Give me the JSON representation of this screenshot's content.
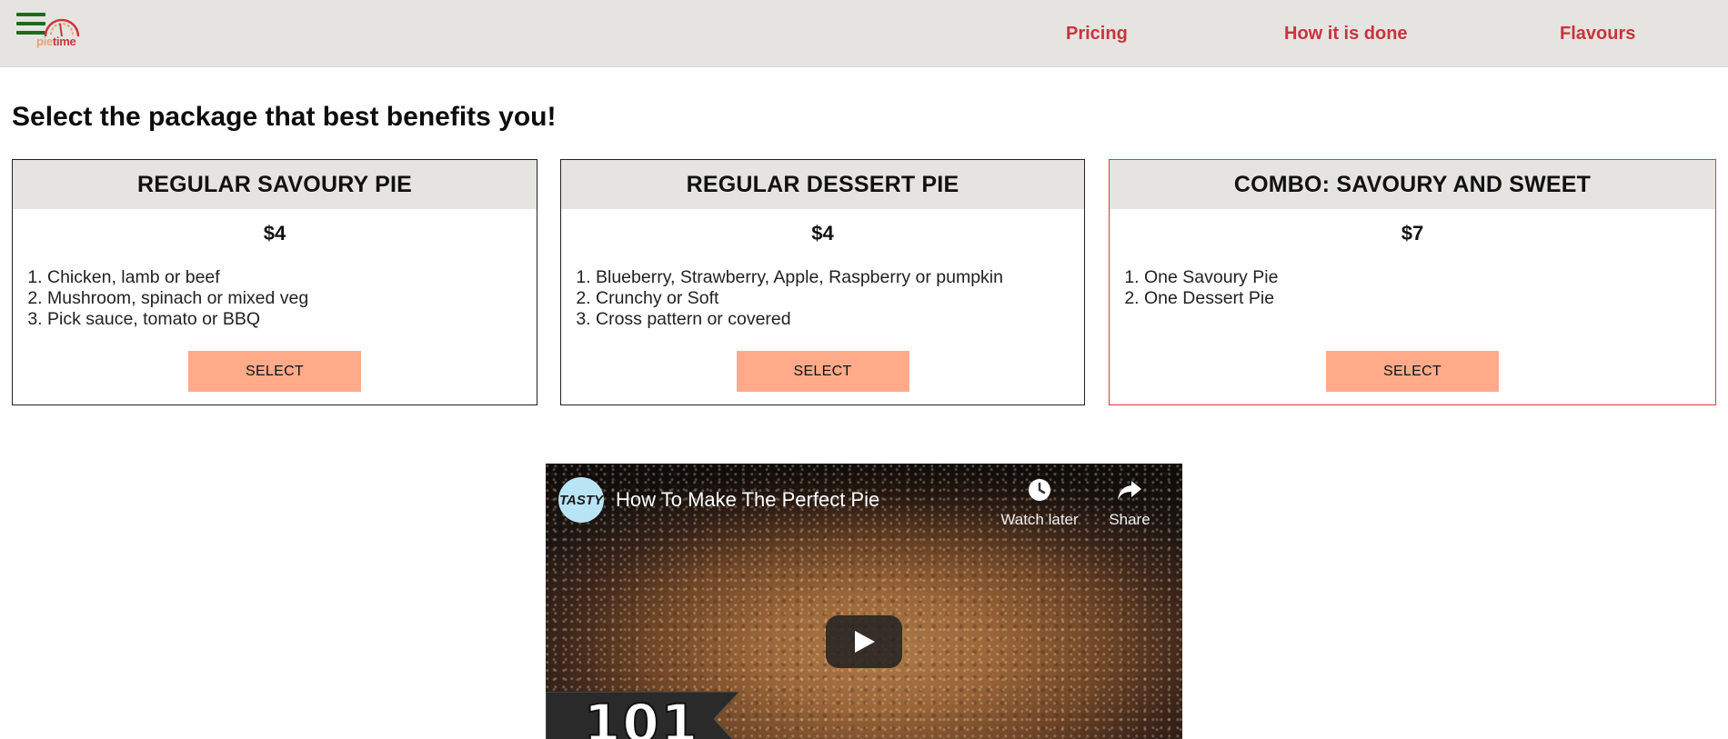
{
  "header": {
    "logo": {
      "pie": "pie",
      "time": "time"
    },
    "nav": [
      {
        "label": "Pricing"
      },
      {
        "label": "How it is done"
      },
      {
        "label": "Flavours"
      }
    ]
  },
  "main": {
    "title": "Select the package that best benefits you!",
    "cards": [
      {
        "name": "REGULAR SAVOURY PIE",
        "price": "$4",
        "items": [
          "Chicken, lamb or beef",
          "Mushroom, spinach or mixed veg",
          "Pick sauce, tomato or BBQ"
        ],
        "button": "SELECT"
      },
      {
        "name": "REGULAR DESSERT PIE",
        "price": "$4",
        "items": [
          "Blueberry, Strawberry, Apple, Raspberry or pumpkin",
          "Crunchy or Soft",
          "Cross pattern or covered"
        ],
        "button": "SELECT"
      },
      {
        "name": "COMBO: SAVOURY AND SWEET",
        "price": "$7",
        "items": [
          "One Savoury Pie",
          "One Dessert Pie"
        ],
        "button": "SELECT"
      }
    ]
  },
  "video": {
    "channel": "TASTY",
    "title": "How To Make The Perfect Pie",
    "watch_later": "Watch later",
    "share": "Share",
    "badge": "101"
  },
  "colors": {
    "header_bg": "#e5e4e1",
    "nav_link": "#c8343b",
    "select_button": "#ffab8a",
    "highlight_border": "#e0393f",
    "hamburger": "#1d6b1d"
  },
  "icons": [
    "hamburger-icon",
    "logo-icon",
    "clock-icon",
    "share-icon",
    "play-icon"
  ]
}
